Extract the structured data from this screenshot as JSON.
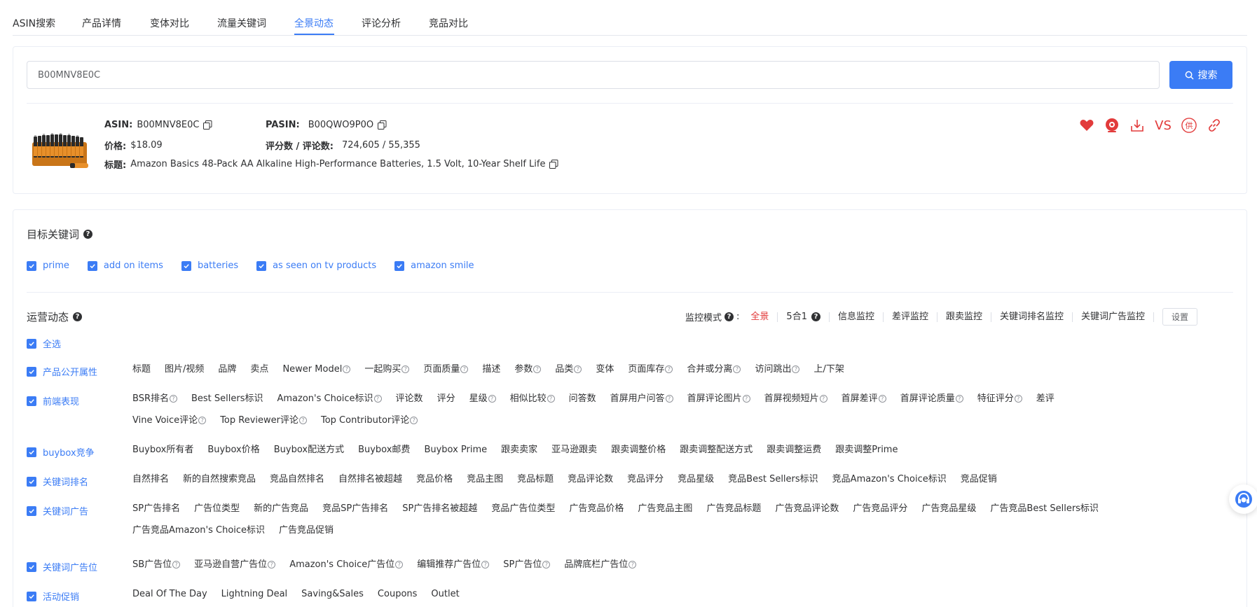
{
  "tabs": [
    {
      "label": "ASIN搜索"
    },
    {
      "label": "产品详情"
    },
    {
      "label": "变体对比"
    },
    {
      "label": "流量关键词"
    },
    {
      "label": "全景动态"
    },
    {
      "label": "评论分析"
    },
    {
      "label": "竞品对比"
    }
  ],
  "active_tab": "全景动态",
  "search": {
    "value": "B00MNV8E0C",
    "button_label": "搜索"
  },
  "product": {
    "asin_label": "ASIN:",
    "asin": "B00MNV8E0C",
    "pasin_label": "PASIN:",
    "pasin": "B00QWO9P0O",
    "price_label": "价格:",
    "price": "$18.09",
    "rating_label": "评分数 / 评论数:",
    "rating": "724,605 / 55,355",
    "title_label": "标题:",
    "title": "Amazon Basics 48-Pack AA Alkaline High-Performance Batteries, 1.5 Volt, 10-Year Shelf Life",
    "vs_label": "VS",
    "supplier_glyph": "供"
  },
  "keywords": {
    "title": "目标关键词",
    "items": [
      "prime",
      "add on items",
      "batteries",
      "as seen on tv products",
      "amazon smile"
    ]
  },
  "operations": {
    "title": "运营动态",
    "select_all": "全选",
    "monitor_label": "监控模式",
    "monitor_options": [
      "全景",
      "5合1",
      "信息监控",
      "差评监控",
      "跟卖监控",
      "关键词排名监控",
      "关键词广告监控"
    ],
    "active_option": "全景",
    "settings_label": "设置",
    "categories": [
      {
        "name": "产品公开属性",
        "items": [
          {
            "t": "标题",
            "q": false
          },
          {
            "t": "图片/视频",
            "q": false
          },
          {
            "t": "品牌",
            "q": false
          },
          {
            "t": "卖点",
            "q": false
          },
          {
            "t": "Newer Model",
            "q": true
          },
          {
            "t": "一起购买",
            "q": true
          },
          {
            "t": "页面质量",
            "q": true
          },
          {
            "t": "描述",
            "q": false
          },
          {
            "t": "参数",
            "q": true
          },
          {
            "t": "品类",
            "q": true
          },
          {
            "t": "变体",
            "q": false
          },
          {
            "t": "页面库存",
            "q": true
          },
          {
            "t": "合并或分离",
            "q": true
          },
          {
            "t": "访问跳出",
            "q": true
          },
          {
            "t": "上/下架",
            "q": false
          }
        ]
      },
      {
        "name": "前端表现",
        "items": [
          {
            "t": "BSR排名",
            "q": true
          },
          {
            "t": "Best Sellers标识",
            "q": false
          },
          {
            "t": "Amazon's Choice标识",
            "q": true
          },
          {
            "t": "评论数",
            "q": false
          },
          {
            "t": "评分",
            "q": false
          },
          {
            "t": "星级",
            "q": true
          },
          {
            "t": "相似比较",
            "q": true
          },
          {
            "t": "问答数",
            "q": false
          },
          {
            "t": "首屏用户问答",
            "q": true
          },
          {
            "t": "首屏评论图片",
            "q": true
          },
          {
            "t": "首屏视频短片",
            "q": true
          },
          {
            "t": "首屏差评",
            "q": true
          },
          {
            "t": "首屏评论质量",
            "q": true
          },
          {
            "t": "特征评分",
            "q": true
          },
          {
            "t": "差评",
            "q": false
          },
          {
            "t": "Vine Voice评论",
            "q": true
          },
          {
            "t": "Top Reviewer评论",
            "q": true
          },
          {
            "t": "Top Contributor评论",
            "q": true
          }
        ]
      },
      {
        "name": "buybox竞争",
        "items": [
          {
            "t": "Buybox所有者",
            "q": false
          },
          {
            "t": "Buybox价格",
            "q": false
          },
          {
            "t": "Buybox配送方式",
            "q": false
          },
          {
            "t": "Buybox邮费",
            "q": false
          },
          {
            "t": "Buybox Prime",
            "q": false
          },
          {
            "t": "跟卖卖家",
            "q": false
          },
          {
            "t": "亚马逊跟卖",
            "q": false
          },
          {
            "t": "跟卖调整价格",
            "q": false
          },
          {
            "t": "跟卖调整配送方式",
            "q": false
          },
          {
            "t": "跟卖调整运费",
            "q": false
          },
          {
            "t": "跟卖调整Prime",
            "q": false
          }
        ]
      },
      {
        "name": "关键词排名",
        "items": [
          {
            "t": "自然排名",
            "q": false
          },
          {
            "t": "新的自然搜索竞品",
            "q": false
          },
          {
            "t": "竞品自然排名",
            "q": false
          },
          {
            "t": "自然排名被超越",
            "q": false
          },
          {
            "t": "竞品价格",
            "q": false
          },
          {
            "t": "竞品主图",
            "q": false
          },
          {
            "t": "竞品标题",
            "q": false
          },
          {
            "t": "竞品评论数",
            "q": false
          },
          {
            "t": "竞品评分",
            "q": false
          },
          {
            "t": "竞品星级",
            "q": false
          },
          {
            "t": "竞品Best Sellers标识",
            "q": false
          },
          {
            "t": "竞品Amazon's Choice标识",
            "q": false
          },
          {
            "t": "竞品促销",
            "q": false
          }
        ]
      },
      {
        "name": "关键词广告",
        "items": [
          {
            "t": "SP广告排名",
            "q": false
          },
          {
            "t": "广告位类型",
            "q": false
          },
          {
            "t": "新的广告竞品",
            "q": false
          },
          {
            "t": "竞品SP广告排名",
            "q": false
          },
          {
            "t": "SP广告排名被超越",
            "q": false
          },
          {
            "t": "竞品广告位类型",
            "q": false
          },
          {
            "t": "广告竞品价格",
            "q": false
          },
          {
            "t": "广告竞品主图",
            "q": false
          },
          {
            "t": "广告竞品标题",
            "q": false
          },
          {
            "t": "广告竞品评论数",
            "q": false
          },
          {
            "t": "广告竞品评分",
            "q": false
          },
          {
            "t": "广告竞品星级",
            "q": false
          },
          {
            "t": "广告竞品Best Sellers标识",
            "q": false
          },
          {
            "t": "广告竞品Amazon's Choice标识",
            "q": false
          },
          {
            "t": "广告竞品促销",
            "q": false
          }
        ]
      },
      {
        "name": "关键词广告位",
        "items": [
          {
            "t": "SB广告位",
            "q": true
          },
          {
            "t": "亚马逊自营广告位",
            "q": true
          },
          {
            "t": "Amazon's Choice广告位",
            "q": true
          },
          {
            "t": "编辑推荐广告位",
            "q": true
          },
          {
            "t": "SP广告位",
            "q": true
          },
          {
            "t": "品牌底栏广告位",
            "q": true
          }
        ]
      },
      {
        "name": "活动促销",
        "items": [
          {
            "t": "Deal Of The Day",
            "q": false
          },
          {
            "t": "Lightning Deal",
            "q": false
          },
          {
            "t": "Saving&Sales",
            "q": false
          },
          {
            "t": "Coupons",
            "q": false
          },
          {
            "t": "Outlet",
            "q": false
          }
        ]
      }
    ]
  },
  "colors": {
    "accent": "#3b7cf5",
    "danger": "#e23b3b"
  },
  "icons": [
    "search-icon",
    "copy-icon",
    "heart-icon",
    "camera-icon",
    "download-icon",
    "supplier-icon",
    "link-icon",
    "help-icon",
    "checkbox-checked-icon",
    "customer-service-icon"
  ]
}
